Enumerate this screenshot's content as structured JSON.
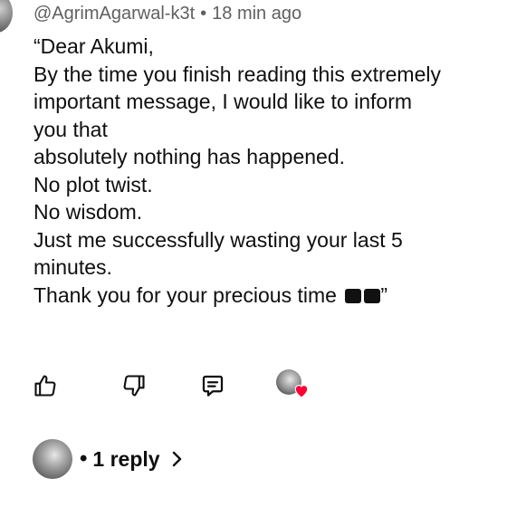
{
  "comment": {
    "author": "@AgrimAgarwal-k3t",
    "separator": "•",
    "timestamp": "18 min ago",
    "lines": [
      "“Dear Akumi,",
      "By the time you finish reading this extremely",
      "important message, I would like to inform",
      "you that",
      "absolutely nothing has happened.",
      "No plot twist.",
      "No wisdom.",
      "Just me successfully wasting your last 5",
      "minutes.",
      "Thank you for your precious time"
    ],
    "closing_quote": "”"
  },
  "actions": {
    "like_icon": "thumbs-up-icon",
    "dislike_icon": "thumbs-down-icon",
    "reply_icon": "comment-reply-icon",
    "creator_heart_icon": "heart-icon",
    "heart_color": "#ff0033"
  },
  "replies": {
    "bullet": "•",
    "label": "1 reply",
    "chevron_icon": "chevron-right-icon"
  }
}
